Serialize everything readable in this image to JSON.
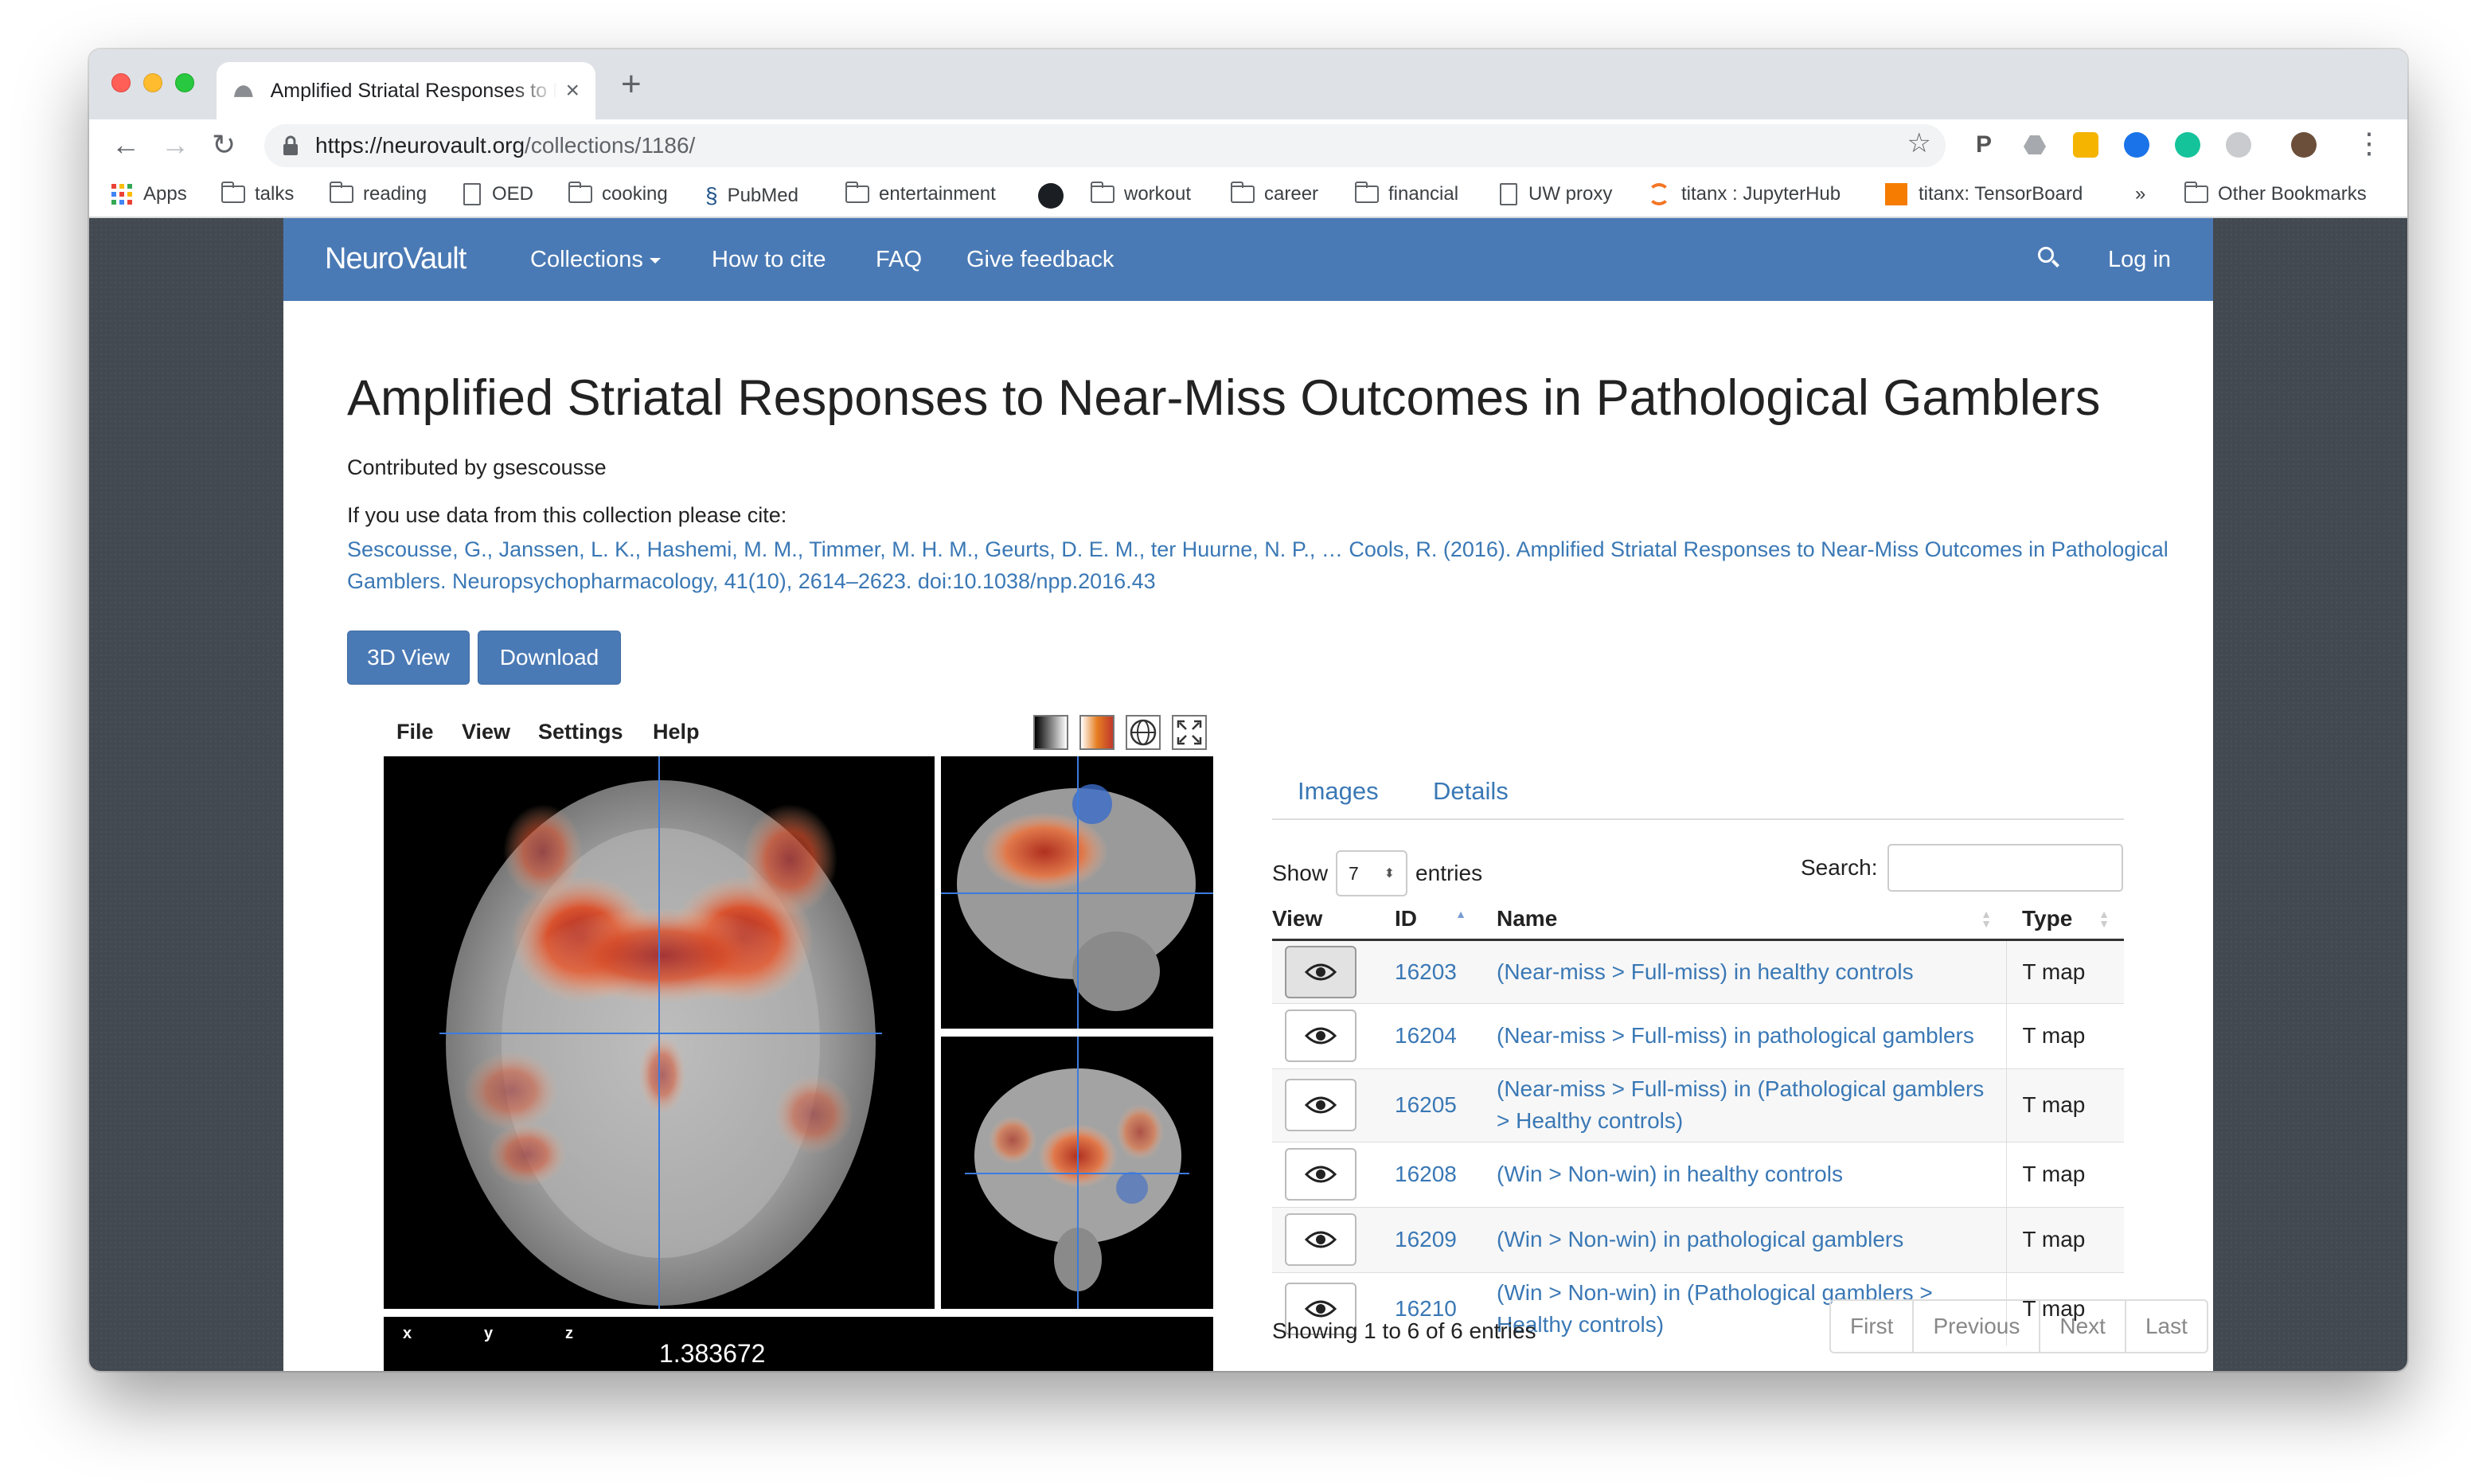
{
  "browser": {
    "tab_title": "Amplified Striatal Responses to Near-Miss Outcomes in Pathological Gamblers | NeuroVault",
    "tab_close": "×",
    "new_tab": "+",
    "url_host": "https://neurovault.org",
    "url_path": "/collections/1186/",
    "bookmarks": [
      "Apps",
      "talks",
      "reading",
      "OED",
      "cooking",
      "PubMed",
      "entertainment",
      "",
      "workout",
      "career",
      "financial",
      "UW proxy",
      "titanx : JupyterHub",
      "titanx: TensorBoard",
      "»",
      "Other Bookmarks"
    ]
  },
  "navbar": {
    "brand": "NeuroVault",
    "links": [
      "Collections",
      "How to cite",
      "FAQ",
      "Give feedback"
    ],
    "login": "Log in"
  },
  "page": {
    "title": "Amplified Striatal Responses to Near-Miss Outcomes in Pathological Gamblers",
    "contributed": "Contributed by gsescousse",
    "cite_label": "If you use data from this collection please cite:",
    "citation": "Sescousse, G., Janssen, L. K., Hashemi, M. M., Timmer, M. H. M., Geurts, D. E. M., ter Huurne, N. P., … Cools, R. (2016). Amplified Striatal Responses to Near-Miss Outcomes in Pathological Gamblers. Neuropsychopharmacology, 41(10), 2614–2623. doi:10.1038/npp.2016.43",
    "btn_3d": "3D View",
    "btn_download": "Download"
  },
  "viewer": {
    "menu": [
      "File",
      "View",
      "Settings",
      "Help"
    ],
    "coord_labels": [
      "x",
      "y",
      "z"
    ],
    "value": "1.383672"
  },
  "table_panel": {
    "tabs": [
      "Images",
      "Details"
    ],
    "show_label": "Show",
    "entries_label": "entries",
    "page_length": "7",
    "search_label": "Search:",
    "columns": [
      "View",
      "ID",
      "Name",
      "Type"
    ],
    "rows": [
      {
        "id": "16203",
        "name": "(Near-miss > Full-miss) in healthy controls",
        "type": "T map"
      },
      {
        "id": "16204",
        "name": "(Near-miss > Full-miss) in pathological gamblers",
        "type": "T map"
      },
      {
        "id": "16205",
        "name": "(Near-miss > Full-miss) in (Pathological gamblers > Healthy controls)",
        "type": "T map"
      },
      {
        "id": "16208",
        "name": "(Win > Non-win) in healthy controls",
        "type": "T map"
      },
      {
        "id": "16209",
        "name": "(Win > Non-win) in pathological gamblers",
        "type": "T map"
      },
      {
        "id": "16210",
        "name": "(Win > Non-win) in (Pathological gamblers > Healthy controls)",
        "type": "T map"
      }
    ],
    "info": "Showing 1 to 6 of 6 entries",
    "pager": [
      "First",
      "Previous",
      "Next",
      "Last"
    ]
  },
  "colors": {
    "navbar": "#4a7ab5",
    "link": "#3a78b5",
    "heat": "#c0392b",
    "crosshair": "#3b7be0"
  }
}
